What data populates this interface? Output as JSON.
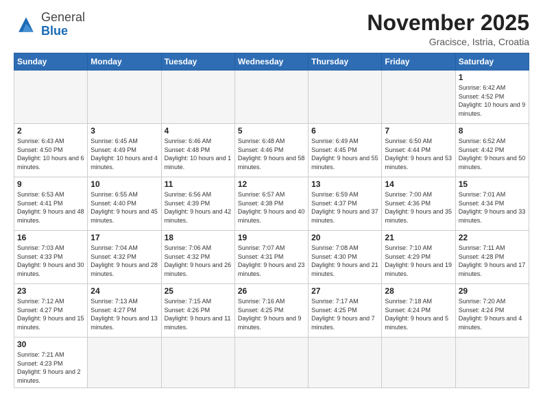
{
  "header": {
    "logo_general": "General",
    "logo_blue": "Blue",
    "title": "November 2025",
    "location": "Gracisce, Istria, Croatia"
  },
  "days_of_week": [
    "Sunday",
    "Monday",
    "Tuesday",
    "Wednesday",
    "Thursday",
    "Friday",
    "Saturday"
  ],
  "weeks": [
    [
      {
        "day": "",
        "info": ""
      },
      {
        "day": "",
        "info": ""
      },
      {
        "day": "",
        "info": ""
      },
      {
        "day": "",
        "info": ""
      },
      {
        "day": "",
        "info": ""
      },
      {
        "day": "",
        "info": ""
      },
      {
        "day": "1",
        "info": "Sunrise: 6:42 AM\nSunset: 4:52 PM\nDaylight: 10 hours\nand 9 minutes."
      }
    ],
    [
      {
        "day": "2",
        "info": "Sunrise: 6:43 AM\nSunset: 4:50 PM\nDaylight: 10 hours\nand 6 minutes."
      },
      {
        "day": "3",
        "info": "Sunrise: 6:45 AM\nSunset: 4:49 PM\nDaylight: 10 hours\nand 4 minutes."
      },
      {
        "day": "4",
        "info": "Sunrise: 6:46 AM\nSunset: 4:48 PM\nDaylight: 10 hours\nand 1 minute."
      },
      {
        "day": "5",
        "info": "Sunrise: 6:48 AM\nSunset: 4:46 PM\nDaylight: 9 hours\nand 58 minutes."
      },
      {
        "day": "6",
        "info": "Sunrise: 6:49 AM\nSunset: 4:45 PM\nDaylight: 9 hours\nand 55 minutes."
      },
      {
        "day": "7",
        "info": "Sunrise: 6:50 AM\nSunset: 4:44 PM\nDaylight: 9 hours\nand 53 minutes."
      },
      {
        "day": "8",
        "info": "Sunrise: 6:52 AM\nSunset: 4:42 PM\nDaylight: 9 hours\nand 50 minutes."
      }
    ],
    [
      {
        "day": "9",
        "info": "Sunrise: 6:53 AM\nSunset: 4:41 PM\nDaylight: 9 hours\nand 48 minutes."
      },
      {
        "day": "10",
        "info": "Sunrise: 6:55 AM\nSunset: 4:40 PM\nDaylight: 9 hours\nand 45 minutes."
      },
      {
        "day": "11",
        "info": "Sunrise: 6:56 AM\nSunset: 4:39 PM\nDaylight: 9 hours\nand 42 minutes."
      },
      {
        "day": "12",
        "info": "Sunrise: 6:57 AM\nSunset: 4:38 PM\nDaylight: 9 hours\nand 40 minutes."
      },
      {
        "day": "13",
        "info": "Sunrise: 6:59 AM\nSunset: 4:37 PM\nDaylight: 9 hours\nand 37 minutes."
      },
      {
        "day": "14",
        "info": "Sunrise: 7:00 AM\nSunset: 4:36 PM\nDaylight: 9 hours\nand 35 minutes."
      },
      {
        "day": "15",
        "info": "Sunrise: 7:01 AM\nSunset: 4:34 PM\nDaylight: 9 hours\nand 33 minutes."
      }
    ],
    [
      {
        "day": "16",
        "info": "Sunrise: 7:03 AM\nSunset: 4:33 PM\nDaylight: 9 hours\nand 30 minutes."
      },
      {
        "day": "17",
        "info": "Sunrise: 7:04 AM\nSunset: 4:32 PM\nDaylight: 9 hours\nand 28 minutes."
      },
      {
        "day": "18",
        "info": "Sunrise: 7:06 AM\nSunset: 4:32 PM\nDaylight: 9 hours\nand 26 minutes."
      },
      {
        "day": "19",
        "info": "Sunrise: 7:07 AM\nSunset: 4:31 PM\nDaylight: 9 hours\nand 23 minutes."
      },
      {
        "day": "20",
        "info": "Sunrise: 7:08 AM\nSunset: 4:30 PM\nDaylight: 9 hours\nand 21 minutes."
      },
      {
        "day": "21",
        "info": "Sunrise: 7:10 AM\nSunset: 4:29 PM\nDaylight: 9 hours\nand 19 minutes."
      },
      {
        "day": "22",
        "info": "Sunrise: 7:11 AM\nSunset: 4:28 PM\nDaylight: 9 hours\nand 17 minutes."
      }
    ],
    [
      {
        "day": "23",
        "info": "Sunrise: 7:12 AM\nSunset: 4:27 PM\nDaylight: 9 hours\nand 15 minutes."
      },
      {
        "day": "24",
        "info": "Sunrise: 7:13 AM\nSunset: 4:27 PM\nDaylight: 9 hours\nand 13 minutes."
      },
      {
        "day": "25",
        "info": "Sunrise: 7:15 AM\nSunset: 4:26 PM\nDaylight: 9 hours\nand 11 minutes."
      },
      {
        "day": "26",
        "info": "Sunrise: 7:16 AM\nSunset: 4:25 PM\nDaylight: 9 hours\nand 9 minutes."
      },
      {
        "day": "27",
        "info": "Sunrise: 7:17 AM\nSunset: 4:25 PM\nDaylight: 9 hours\nand 7 minutes."
      },
      {
        "day": "28",
        "info": "Sunrise: 7:18 AM\nSunset: 4:24 PM\nDaylight: 9 hours\nand 5 minutes."
      },
      {
        "day": "29",
        "info": "Sunrise: 7:20 AM\nSunset: 4:24 PM\nDaylight: 9 hours\nand 4 minutes."
      }
    ],
    [
      {
        "day": "30",
        "info": "Sunrise: 7:21 AM\nSunset: 4:23 PM\nDaylight: 9 hours\nand 2 minutes."
      },
      {
        "day": "",
        "info": ""
      },
      {
        "day": "",
        "info": ""
      },
      {
        "day": "",
        "info": ""
      },
      {
        "day": "",
        "info": ""
      },
      {
        "day": "",
        "info": ""
      },
      {
        "day": "",
        "info": ""
      }
    ]
  ]
}
